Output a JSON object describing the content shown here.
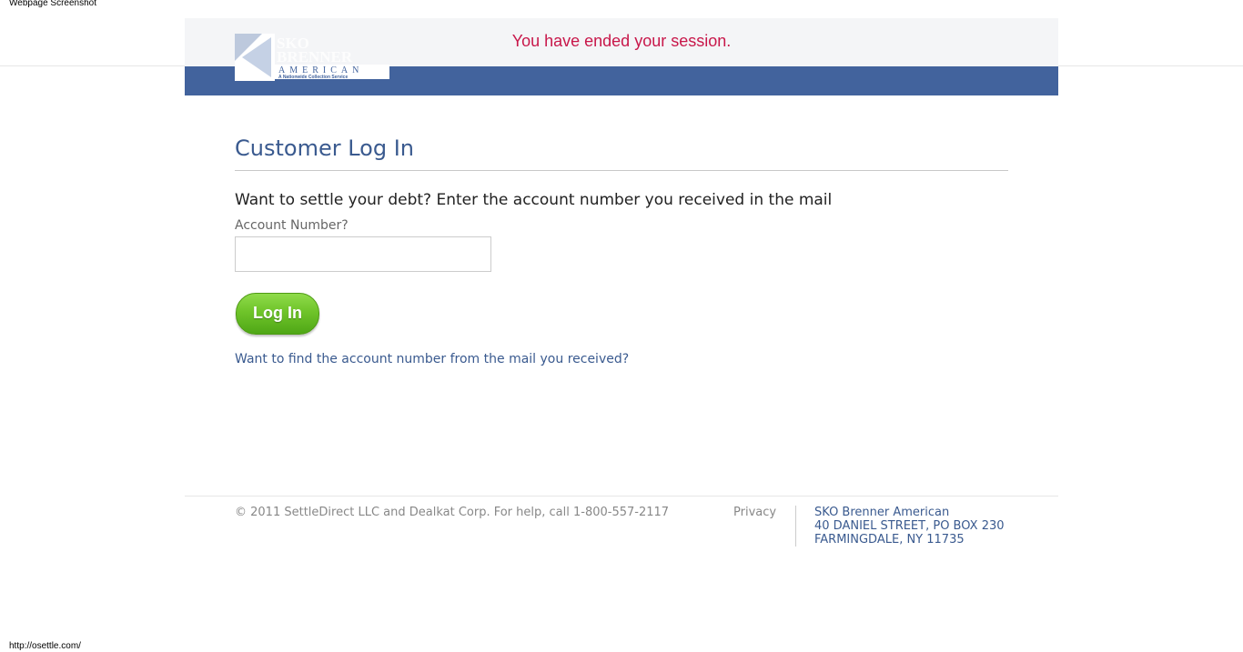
{
  "print": {
    "header": "Webpage Screenshot",
    "url": "http://osettle.com/"
  },
  "header": {
    "session_message": "You have ended your session.",
    "logo": {
      "line1": "SKO",
      "line2": "BRENNER",
      "line3": "AMERICAN",
      "tagline": "A Nationwide Collection Service"
    }
  },
  "login": {
    "title": "Customer Log In",
    "prompt": "Want to settle your debt? Enter the account number you received in the mail",
    "account_label": "Account Number?",
    "account_value": "",
    "account_placeholder": "",
    "button_label": "Log In",
    "find_link": "Want to find the account number from the mail you received?"
  },
  "footer": {
    "copyright": "© 2011 SettleDirect LLC and Dealkat Corp. For help, call 1-800-557-2117",
    "privacy": "Privacy",
    "address": {
      "company": "SKO Brenner American",
      "street": "40 DANIEL STREET, PO BOX 230",
      "city": "FARMINGDALE, NY 11735"
    }
  },
  "colors": {
    "header_blue": "#42639d",
    "session_red": "#c8174a",
    "link_blue": "#3a5a8f",
    "button_green": "#6fc42a"
  }
}
